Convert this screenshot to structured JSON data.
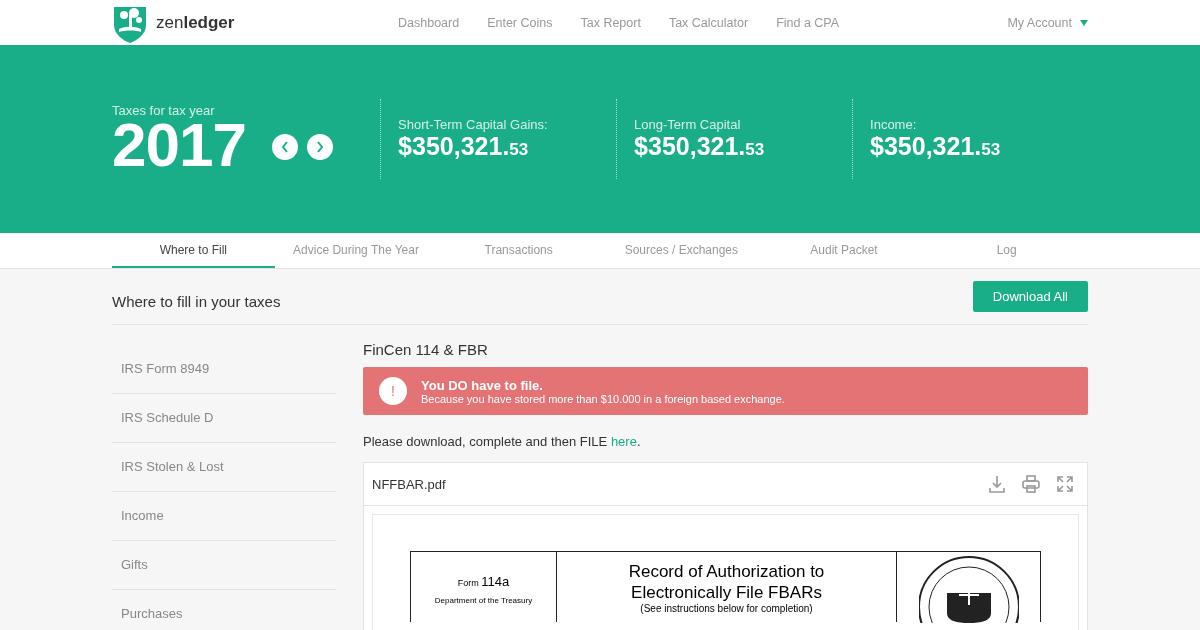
{
  "brand": {
    "name_light": "zen",
    "name_bold": "ledger"
  },
  "nav": [
    {
      "label": "Dashboard"
    },
    {
      "label": "Enter Coins"
    },
    {
      "label": "Tax Report"
    },
    {
      "label": "Tax Calculator"
    },
    {
      "label": "Find a CPA"
    }
  ],
  "account": {
    "label": "My Account"
  },
  "hero": {
    "caption": "Taxes for tax year",
    "year": "2017",
    "stats": [
      {
        "label": "Short-Term Capital Gains:",
        "whole": "$350,321.",
        "cents": "53"
      },
      {
        "label": "Long-Term Capital",
        "whole": "$350,321.",
        "cents": "53"
      },
      {
        "label": "Income:",
        "whole": "$350,321.",
        "cents": "53"
      }
    ]
  },
  "tabs": [
    {
      "label": "Where to Fill",
      "selected": true
    },
    {
      "label": "Advice During The Year",
      "selected": false
    },
    {
      "label": "Transactions",
      "selected": false
    },
    {
      "label": "Sources / Exchanges",
      "selected": false
    },
    {
      "label": "Audit Packet",
      "selected": false
    },
    {
      "label": "Log",
      "selected": false
    }
  ],
  "section": {
    "title": "Where to fill in your taxes",
    "button": "Download All"
  },
  "sidebar": {
    "items": [
      {
        "label": "IRS Form 8949"
      },
      {
        "label": "IRS Schedule D"
      },
      {
        "label": "IRS Stolen & Lost"
      },
      {
        "label": "Income"
      },
      {
        "label": "Gifts"
      },
      {
        "label": "Purchases"
      }
    ]
  },
  "detail": {
    "title": "FinCen 114 & FBR",
    "alert": {
      "icon": "!",
      "title": "You DO have to file.",
      "message": "Because you have stored more than $10.000 in a foreign based exchange."
    },
    "instruction": "Please download, complete and then FILE ",
    "link": "here",
    "after_link": ".",
    "viewer": {
      "filename": "NFFBAR.pdf",
      "form": {
        "form_label": "Form",
        "form_number": "114a",
        "department": "Department of the Treasury",
        "title_lines": [
          "Record of Authorization to",
          "Electronically File FBARs"
        ],
        "subtitle": "(See instructions below for completion)"
      }
    }
  }
}
